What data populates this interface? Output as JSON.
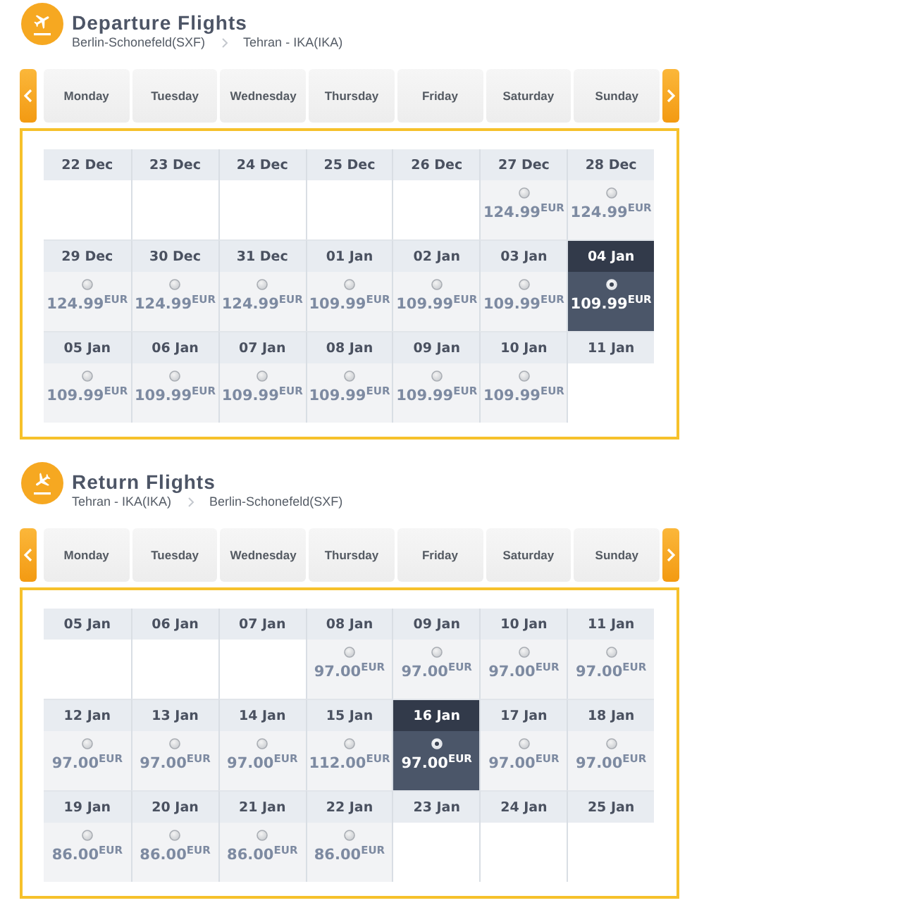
{
  "sections": [
    {
      "kind": "departure",
      "title": "Departure Flights",
      "origin": "Berlin-Schonefeld(SXF)",
      "destination": "Tehran - IKA(IKA)",
      "weekdays": [
        "Monday",
        "Tuesday",
        "Wednesday",
        "Thursday",
        "Friday",
        "Saturday",
        "Sunday"
      ],
      "days": [
        {
          "date": "22 Dec",
          "selected": false
        },
        {
          "date": "23 Dec",
          "selected": false
        },
        {
          "date": "24 Dec",
          "selected": false
        },
        {
          "date": "25 Dec",
          "selected": false
        },
        {
          "date": "26 Dec",
          "selected": false
        },
        {
          "date": "27 Dec",
          "price": "124.99$^{EUR}$",
          "selected": false
        },
        {
          "date": "28 Dec",
          "price": "124.99$^{EUR}$",
          "selected": false
        },
        {
          "date": "29 Dec",
          "price": "124.99$^{EUR}$",
          "selected": false
        },
        {
          "date": "30 Dec",
          "price": "124.99$^{EUR}$",
          "selected": false
        },
        {
          "date": "31 Dec",
          "price": "124.99$^{EUR}$",
          "selected": false
        },
        {
          "date": "01 Jan",
          "price": "109.99$^{EUR}$",
          "selected": false
        },
        {
          "date": "02 Jan",
          "price": "109.99$^{EUR}$",
          "selected": false
        },
        {
          "date": "03 Jan",
          "price": "109.99$^{EUR}$",
          "selected": false
        },
        {
          "date": "04 Jan",
          "price": "109.99$^{EUR}$",
          "selected": true
        },
        {
          "date": "05 Jan",
          "price": "109.99$^{EUR}$",
          "selected": false
        },
        {
          "date": "06 Jan",
          "price": "109.99$^{EUR}$",
          "selected": false
        },
        {
          "date": "07 Jan",
          "price": "109.99$^{EUR}$",
          "selected": false
        },
        {
          "date": "08 Jan",
          "price": "109.99$^{EUR}$",
          "selected": false
        },
        {
          "date": "09 Jan",
          "price": "109.99$^{EUR}$",
          "selected": false
        },
        {
          "date": "10 Jan",
          "price": "109.99$^{EUR}$",
          "selected": false
        },
        {
          "date": "11 Jan",
          "selected": false
        }
      ]
    },
    {
      "kind": "return",
      "title": "Return Flights",
      "origin": "Tehran - IKA(IKA)",
      "destination": "Berlin-Schonefeld(SXF)",
      "weekdays": [
        "Monday",
        "Tuesday",
        "Wednesday",
        "Thursday",
        "Friday",
        "Saturday",
        "Sunday"
      ],
      "days": [
        {
          "date": "05 Jan",
          "selected": false
        },
        {
          "date": "06 Jan",
          "selected": false
        },
        {
          "date": "07 Jan",
          "selected": false
        },
        {
          "date": "08 Jan",
          "price": "97.00$^{EUR}$",
          "selected": false
        },
        {
          "date": "09 Jan",
          "price": "97.00$^{EUR}$",
          "selected": false
        },
        {
          "date": "10 Jan",
          "price": "97.00$^{EUR}$",
          "selected": false
        },
        {
          "date": "11 Jan",
          "price": "97.00$^{EUR}$",
          "selected": false
        },
        {
          "date": "12 Jan",
          "price": "97.00$^{EUR}$",
          "selected": false
        },
        {
          "date": "13 Jan",
          "price": "97.00$^{EUR}$",
          "selected": false
        },
        {
          "date": "14 Jan",
          "price": "97.00$^{EUR}$",
          "selected": false
        },
        {
          "date": "15 Jan",
          "price": "112.00$^{EUR}$",
          "selected": false
        },
        {
          "date": "16 Jan",
          "price": "97.00$^{EUR}$",
          "selected": true
        },
        {
          "date": "17 Jan",
          "price": "97.00$^{EUR}$",
          "selected": false
        },
        {
          "date": "18 Jan",
          "price": "97.00$^{EUR}$",
          "selected": false
        },
        {
          "date": "19 Jan",
          "price": "86.00$^{EUR}$",
          "selected": false
        },
        {
          "date": "20 Jan",
          "price": "86.00$^{EUR}$",
          "selected": false
        },
        {
          "date": "21 Jan",
          "price": "86.00$^{EUR}$",
          "selected": false
        },
        {
          "date": "22 Jan",
          "price": "86.00$^{EUR}$",
          "selected": false
        },
        {
          "date": "23 Jan",
          "selected": false
        },
        {
          "date": "24 Jan",
          "selected": false
        },
        {
          "date": "25 Jan",
          "selected": false
        }
      ]
    }
  ]
}
